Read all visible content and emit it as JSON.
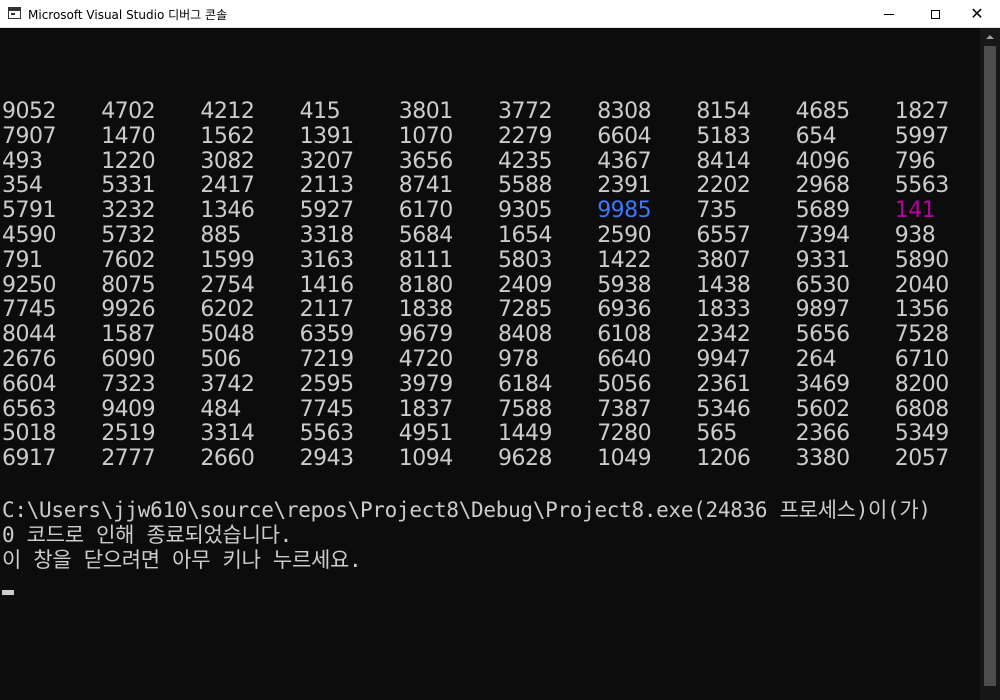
{
  "window": {
    "title": "Microsoft Visual Studio 디버그 콘솔",
    "minimize_label": "—",
    "maximize_label": "□",
    "close_label": "✕"
  },
  "console": {
    "rows": [
      [
        "9052",
        "4702",
        "4212",
        "415",
        "3801",
        "3772",
        "8308",
        "8154",
        "4685",
        "1827"
      ],
      [
        "7907",
        "1470",
        "1562",
        "1391",
        "1070",
        "2279",
        "6604",
        "5183",
        "654",
        "5997"
      ],
      [
        "493",
        "1220",
        "3082",
        "3207",
        "3656",
        "4235",
        "4367",
        "8414",
        "4096",
        "796"
      ],
      [
        "354",
        "5331",
        "2417",
        "2113",
        "8741",
        "5588",
        "2391",
        "2202",
        "2968",
        "5563"
      ],
      [
        "5791",
        "3232",
        "1346",
        "5927",
        "6170",
        "9305",
        "9985",
        "735",
        "5689",
        "141"
      ],
      [
        "4590",
        "5732",
        "885",
        "3318",
        "5684",
        "1654",
        "2590",
        "6557",
        "7394",
        "938"
      ],
      [
        "791",
        "7602",
        "1599",
        "3163",
        "8111",
        "5803",
        "1422",
        "3807",
        "9331",
        "5890"
      ],
      [
        "9250",
        "8075",
        "2754",
        "1416",
        "8180",
        "2409",
        "5938",
        "1438",
        "6530",
        "2040"
      ],
      [
        "7745",
        "9926",
        "6202",
        "2117",
        "1838",
        "7285",
        "6936",
        "1833",
        "9897",
        "1356"
      ],
      [
        "8044",
        "1587",
        "5048",
        "6359",
        "9679",
        "8408",
        "6108",
        "2342",
        "5656",
        "7528"
      ],
      [
        "2676",
        "6090",
        "506",
        "7219",
        "4720",
        "978",
        "6640",
        "9947",
        "264",
        "6710"
      ],
      [
        "6604",
        "7323",
        "3742",
        "2595",
        "3979",
        "6184",
        "5056",
        "2361",
        "3469",
        "8200"
      ],
      [
        "6563",
        "9409",
        "484",
        "7745",
        "1837",
        "7588",
        "7387",
        "5346",
        "5602",
        "6808"
      ],
      [
        "5018",
        "2519",
        "3314",
        "5563",
        "4951",
        "1449",
        "7280",
        "565",
        "2366",
        "5349"
      ],
      [
        "6917",
        "2777",
        "2660",
        "2943",
        "1094",
        "9628",
        "1049",
        "1206",
        "3380",
        "2057"
      ]
    ],
    "highlights": {
      "max_value": "9985",
      "max_color": "#3b78ff",
      "min_value": "141",
      "min_color": "#b4009e"
    },
    "exit_line_1": "C:\\Users\\jjw610\\source\\repos\\Project8\\Debug\\Project8.exe(24836 프로세스)이(가)",
    "exit_line_2": "0 코드로 인해 종료되었습니다.",
    "exit_line_3": "이 창을 닫으려면 아무 키나 누르세요."
  },
  "colors": {
    "console_bg": "#0c0c0c",
    "console_text": "#cccccc",
    "titlebar_bg": "#ffffff"
  }
}
